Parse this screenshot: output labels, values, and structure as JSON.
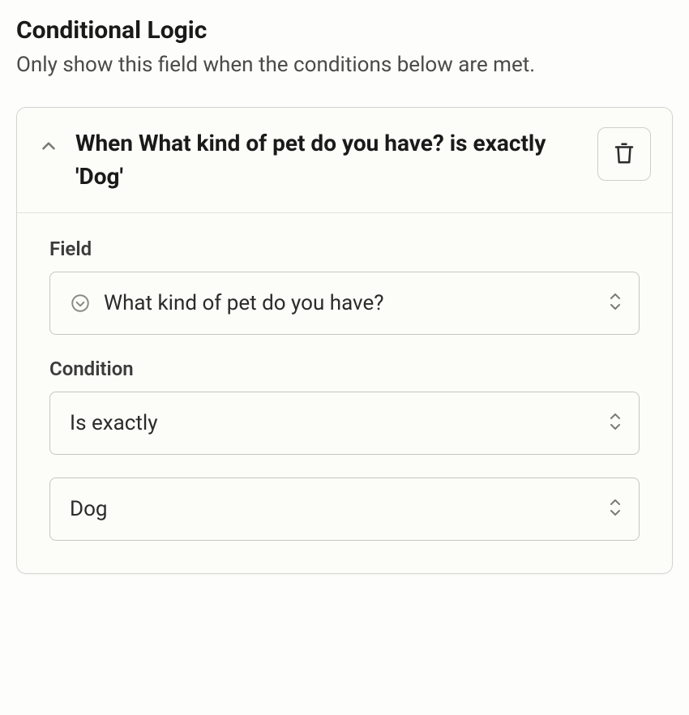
{
  "section": {
    "title": "Conditional Logic",
    "description": "Only show this field when the conditions below are met."
  },
  "rule": {
    "summary": "When What kind of pet do you have? is exactly 'Dog'",
    "field_label": "Field",
    "field_value": "What kind of pet do you have?",
    "condition_label": "Condition",
    "condition_operator": "Is exactly",
    "condition_value": "Dog"
  }
}
